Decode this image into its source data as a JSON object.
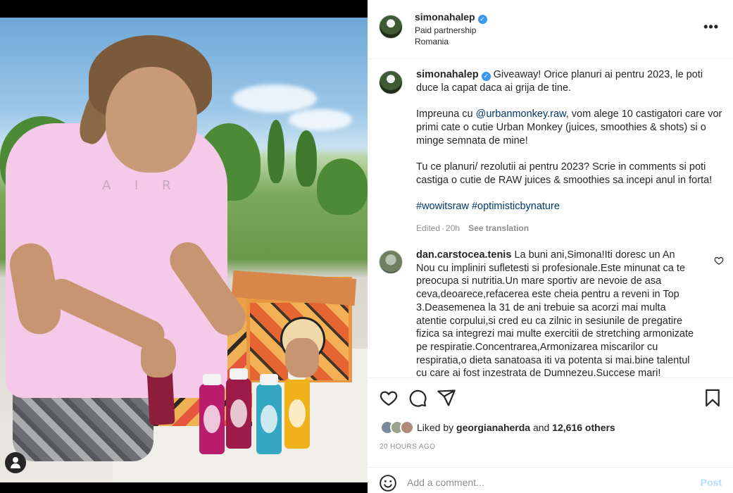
{
  "post": {
    "author": "simonahalep",
    "verified": true,
    "partnership_label": "Paid partnership",
    "location": "Romania",
    "more_icon": "more-horizontal-icon",
    "media": {
      "shirt_text": "A I R",
      "user_tag_icon": "user-tag-icon"
    }
  },
  "caption": {
    "username": "simonahalep",
    "para1": "Giveaway! Orice planuri ai pentru 2023, le poti duce la capat daca ai grija de tine.",
    "para2_before": "Impreuna cu ",
    "para2_mention": "@urbanmonkey.raw",
    "para2_after": ", vom alege 10 castigatori care vor primi cate o cutie Urban Monkey (juices, smoothies & shots) si o minge semnata de mine!",
    "para3": "Tu ce planuri/ rezolutii ai pentru 2023? Scrie in comments si poti castiga o cutie de RAW juices & smoothies sa incepi anul in forta!",
    "hashtag1": "#wowitsraw",
    "hashtag2": "#optimisticbynature",
    "edited": "Edited",
    "dot": "·",
    "age": "20h",
    "see_translation": "See translation"
  },
  "comment": {
    "username": "dan.carstocea.tenis",
    "text": "La buni ani,Simona!Iti doresc un An Nou cu impliniri sufletesti si profesionale.Este minunat ca te preocupa si nutritia.Un mare sportiv are nevoie de asa ceva,deoarece,refacerea este cheia pentru a reveni in Top 3.Deasemenea la 31 de ani trebuie sa acorzi mai multa atentie corpului,si cred eu ca zilnic in sesiunile de pregatire fizica sa integrezi mai multe exercitii de stretching armonizate pe respiratie.Concentrarea,Armonizarea miscarilor cu respiratia,o dieta sanatoasa iti va potenta si mai.bine talentul cu care ai fost inzestrata de Dumnezeu.Succese mari!"
  },
  "actions": {
    "like_icon": "heart-icon",
    "comment_icon": "comment-icon",
    "share_icon": "share-icon",
    "save_icon": "bookmark-icon",
    "liked_by_prefix": "Liked by",
    "liked_by_user": "georgianaherda",
    "and": "and",
    "others": "12,616 others",
    "timestamp": "20 HOURS AGO"
  },
  "add_comment": {
    "emoji_icon": "emoji-icon",
    "placeholder": "Add a comment...",
    "post_label": "Post"
  },
  "colors": {
    "link": "#00376b",
    "verified": "#3897f0",
    "muted": "#8e8e8e",
    "post_button_disabled": "#b2dffc"
  }
}
